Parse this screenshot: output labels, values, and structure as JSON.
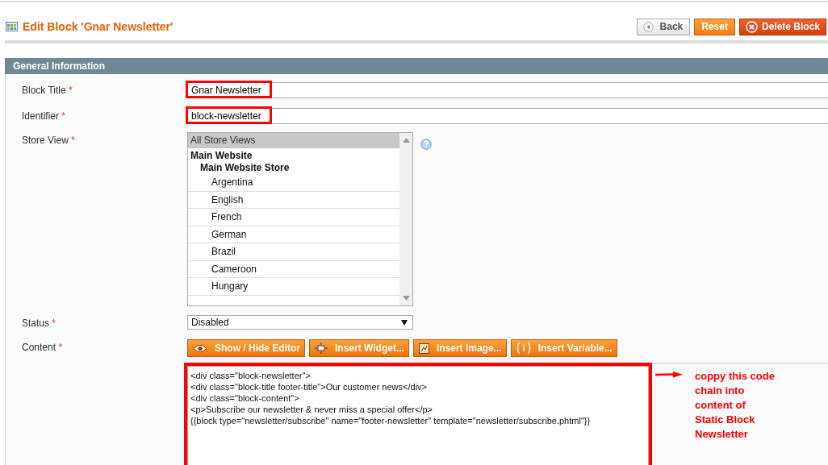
{
  "page_title": "Edit Block 'Gnar Newsletter'",
  "header_buttons": [
    {
      "label": "Back",
      "kind": "back"
    },
    {
      "label": "Reset",
      "kind": "reset"
    },
    {
      "label": "Delete Block",
      "kind": "delete"
    }
  ],
  "section": {
    "title": "General Information"
  },
  "block_title": {
    "label": "Block Title",
    "required_mark": "*",
    "value": "Gnar Newsletter",
    "highlighted": true
  },
  "identifier": {
    "label": "Identifier",
    "required_mark": "*",
    "value": "block-newsletter",
    "highlighted": true
  },
  "store_view": {
    "label": "Store View",
    "required_mark": "*",
    "options": [
      {
        "label": "All Store Views",
        "selected": true
      },
      {
        "label": "Main Website",
        "children": [
          {
            "label": "Main Website Store",
            "children": [
              {
                "label": "Argentina",
                "selected": false
              },
              {
                "label": "English",
                "selected": false
              },
              {
                "label": "French",
                "selected": false
              },
              {
                "label": "German",
                "selected": false
              },
              {
                "label": "Brazil",
                "selected": false
              },
              {
                "label": "Cameroon",
                "selected": false
              },
              {
                "label": "Hungary",
                "selected": false
              }
            ]
          }
        ]
      }
    ]
  },
  "status": {
    "label": "Status",
    "required_mark": "*",
    "value": "Disabled"
  },
  "content": {
    "label": "Content",
    "required_mark": "*",
    "highlighted": true,
    "editor_buttons": [
      {
        "label": "Show / Hide Editor",
        "kind": "toggle"
      },
      {
        "label": "Insert Widget...",
        "kind": "widget"
      },
      {
        "label": "Insert Image...",
        "kind": "image"
      },
      {
        "label": "Insert Variable...",
        "kind": "variable"
      }
    ],
    "code_lines": [
      "<div class=\"block-newsletter\">",
      "<div class=\"block-title footer-title\">Our customer news</div>",
      "<div class=\"block-content\">",
      "<p>Subscribe our newsletter & never miss a special offer</p>",
      "{{block type=\"newsletter/subscribe\" name=\"footer-newsletter\" template=\"newsletter/subscribe.phtml\"}}"
    ]
  },
  "annotation": {
    "lines": [
      "coppy this code",
      "chain into",
      "content of",
      "Static Block",
      "Newsletter"
    ]
  }
}
